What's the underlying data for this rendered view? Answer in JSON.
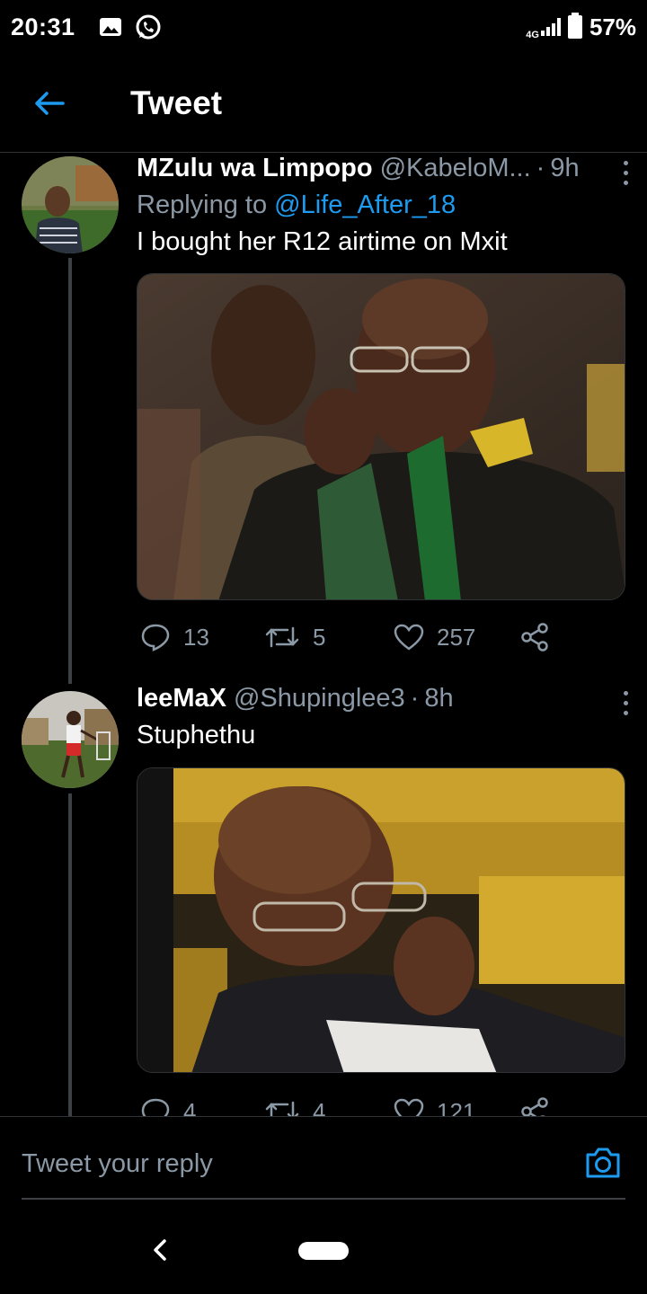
{
  "status_bar": {
    "time": "20:31",
    "network": "4G",
    "battery": "57%",
    "icons_left": [
      "gallery-icon",
      "whatsapp-icon"
    ]
  },
  "header": {
    "title": "Tweet",
    "back_icon": "arrow-left-icon",
    "accent_color": "#1d9bf0"
  },
  "tweets": [
    {
      "name": "MZulu wa Limpopo",
      "handle": "@KabeloM...",
      "time": "9h",
      "replying_prefix": "Replying to",
      "replying_to": "@Life_After_18",
      "text": "I bought her R12 airtime on Mxit",
      "media_icon": "photo",
      "counts": {
        "replies": "13",
        "retweets": "5",
        "likes": "257"
      }
    },
    {
      "name": "leeMaX",
      "handle": "@Shupinglee3",
      "time": "8h",
      "text": "Stuphethu",
      "media_icon": "photo",
      "counts": {
        "replies": "4",
        "retweets": "4",
        "likes": "121"
      }
    }
  ],
  "reply_bar": {
    "placeholder": "Tweet your reply",
    "camera_icon": "camera-icon"
  }
}
